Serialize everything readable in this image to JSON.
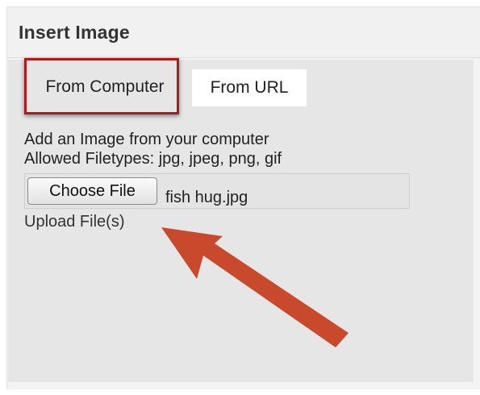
{
  "dialog": {
    "title": "Insert Image"
  },
  "tabs": [
    {
      "label": "From Computer",
      "active": true
    },
    {
      "label": "From URL",
      "active": false
    }
  ],
  "upload": {
    "description": "Add an Image from your computer",
    "allowed_types": "Allowed Filetypes: jpg, jpeg, png, gif",
    "choose_button_label": "Choose File",
    "selected_file": "fish hug.jpg",
    "upload_link": "Upload File(s)"
  },
  "colors": {
    "highlight": "#b01a1a",
    "arrow": "#c9492c"
  },
  "annotations": {
    "highlight_target": "tab-from-computer",
    "arrow_target": "upload-files-link"
  }
}
